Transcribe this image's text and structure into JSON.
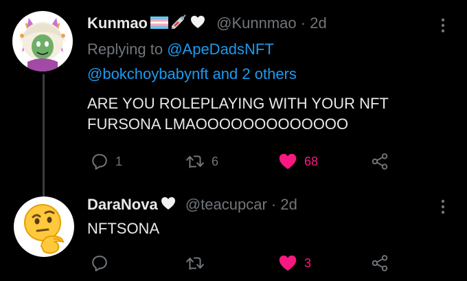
{
  "colors": {
    "background": "#000000",
    "text": "#e7e9ea",
    "muted": "#71767b",
    "link": "#1d9bf0",
    "like": "#f91880",
    "thread_line": "#3a3d41"
  },
  "tweets": [
    {
      "name": "Kunmao",
      "name_icons": [
        "trans-flag-icon",
        "syringe-icon",
        "heart-emoji-icon"
      ],
      "handle": "@Kunnmao",
      "separator": "·",
      "time": "2d",
      "replying_prefix": "Replying to",
      "replying_to": "@ApeDadsNFT",
      "replying_line2_handle": "@bokchoybabynft",
      "replying_line2_rest": " and 2 others",
      "text_lines": [
        "ARE YOU ROLEPLAYING WITH YOUR NFT",
        "FURSONA LMAOOOOOOOOOOOOO"
      ],
      "replies": "1",
      "retweets": "6",
      "likes": "68",
      "liked": true
    },
    {
      "name": "DaraNova",
      "name_icons": [
        "heart-emoji-icon"
      ],
      "handle": "@teacupcar",
      "separator": "·",
      "time": "2d",
      "text_lines": [
        "NFTSONA"
      ],
      "replies": "",
      "retweets": "",
      "likes": "3",
      "liked": true
    }
  ]
}
